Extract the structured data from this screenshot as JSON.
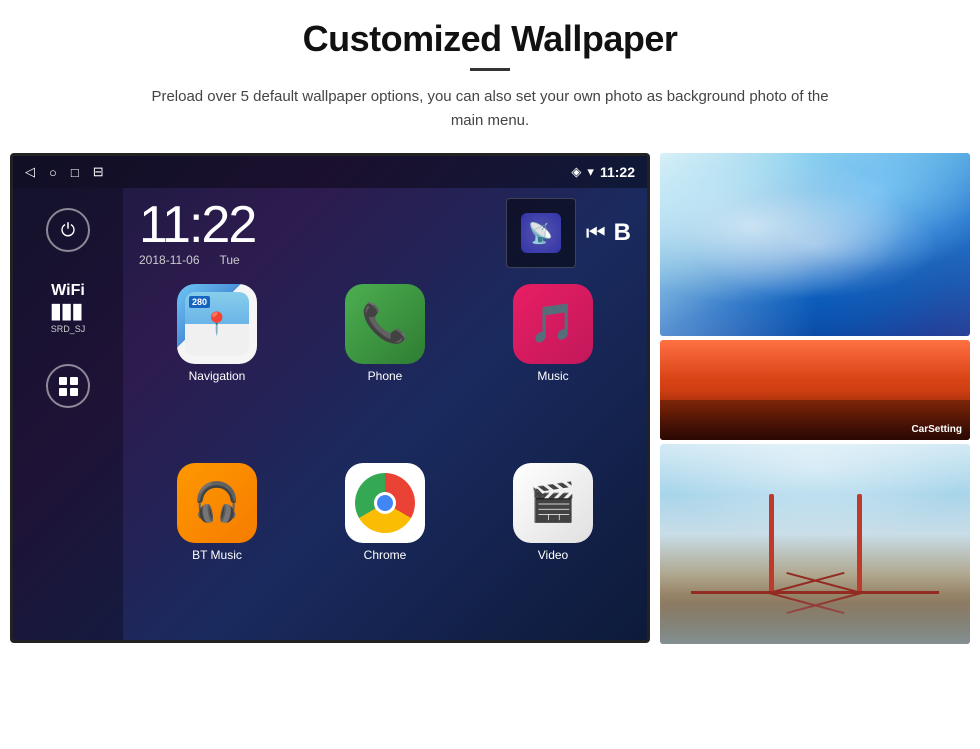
{
  "page": {
    "title": "Customized Wallpaper",
    "description": "Preload over 5 default wallpaper options, you can also set your own photo as background photo of the main menu."
  },
  "android": {
    "statusBar": {
      "time": "11:22",
      "icons": [
        "back",
        "home",
        "recents",
        "screenshot"
      ]
    },
    "clock": {
      "time": "11:22",
      "date": "2018-11-06",
      "day": "Tue"
    },
    "wifi": {
      "label": "WiFi",
      "network": "SRD_SJ"
    },
    "apps": [
      {
        "name": "Navigation",
        "label": "Navigation"
      },
      {
        "name": "Phone",
        "label": "Phone"
      },
      {
        "name": "Music",
        "label": "Music"
      },
      {
        "name": "BT Music",
        "label": "BT Music"
      },
      {
        "name": "Chrome",
        "label": "Chrome"
      },
      {
        "name": "Video",
        "label": "Video"
      }
    ],
    "navBadge": "280"
  }
}
